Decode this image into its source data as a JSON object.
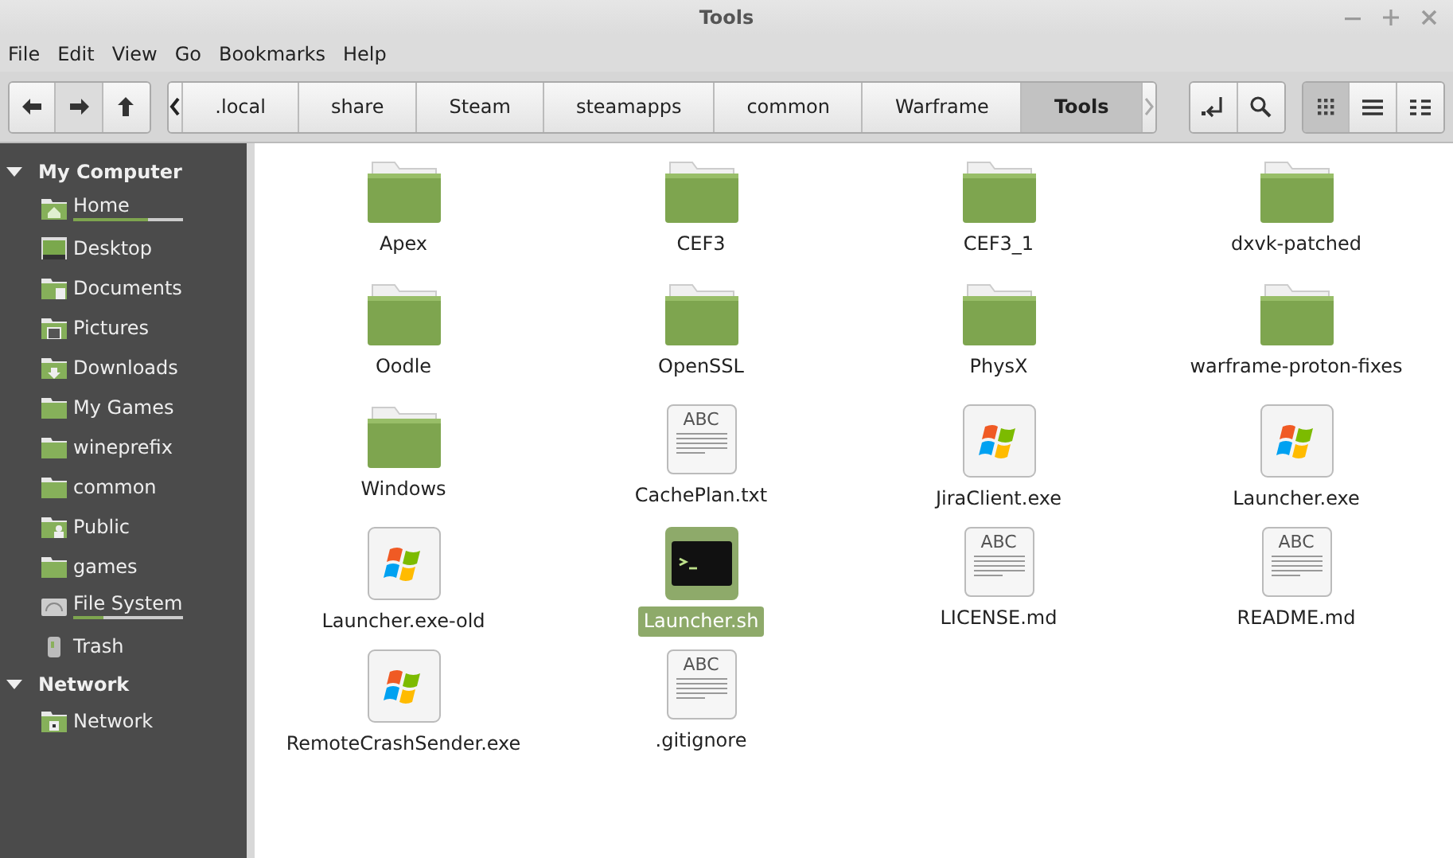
{
  "window": {
    "title": "Tools"
  },
  "menu": [
    "File",
    "Edit",
    "View",
    "Go",
    "Bookmarks",
    "Help"
  ],
  "breadcrumbs": [
    {
      "label": ".local",
      "selected": false
    },
    {
      "label": "share",
      "selected": false
    },
    {
      "label": "Steam",
      "selected": false
    },
    {
      "label": "steamapps",
      "selected": false
    },
    {
      "label": "common",
      "selected": false
    },
    {
      "label": "Warframe",
      "selected": false
    },
    {
      "label": "Tools",
      "selected": true
    }
  ],
  "view_modes": [
    {
      "kind": "icons",
      "selected": true
    },
    {
      "kind": "list",
      "selected": false
    },
    {
      "kind": "compact",
      "selected": false
    }
  ],
  "sidebar": [
    {
      "heading": "My Computer",
      "expanded": true,
      "items": [
        {
          "label": "Home",
          "kind": "home",
          "level": 0.68
        },
        {
          "label": "Desktop",
          "kind": "desktop"
        },
        {
          "label": "Documents",
          "kind": "documents"
        },
        {
          "label": "Pictures",
          "kind": "pictures"
        },
        {
          "label": "Downloads",
          "kind": "downloads"
        },
        {
          "label": "My Games",
          "kind": "folder"
        },
        {
          "label": "wineprefix",
          "kind": "folder"
        },
        {
          "label": "common",
          "kind": "folder"
        },
        {
          "label": "Public",
          "kind": "public"
        },
        {
          "label": "games",
          "kind": "folder"
        },
        {
          "label": "File System",
          "kind": "drive",
          "level": 0.28
        },
        {
          "label": "Trash",
          "kind": "trash"
        }
      ]
    },
    {
      "heading": "Network",
      "expanded": true,
      "items": [
        {
          "label": "Network",
          "kind": "network"
        }
      ]
    }
  ],
  "files": [
    {
      "name": "Apex",
      "kind": "folder",
      "selected": false
    },
    {
      "name": "CEF3",
      "kind": "folder",
      "selected": false
    },
    {
      "name": "CEF3_1",
      "kind": "folder",
      "selected": false
    },
    {
      "name": "dxvk-patched",
      "kind": "folder",
      "selected": false
    },
    {
      "name": "Oodle",
      "kind": "folder",
      "selected": false
    },
    {
      "name": "OpenSSL",
      "kind": "folder",
      "selected": false
    },
    {
      "name": "PhysX",
      "kind": "folder",
      "selected": false
    },
    {
      "name": "warframe-proton-fixes",
      "kind": "folder",
      "selected": false
    },
    {
      "name": "Windows",
      "kind": "folder",
      "selected": false
    },
    {
      "name": "CachePlan.txt",
      "kind": "text",
      "icon_text": "ABC",
      "selected": false
    },
    {
      "name": "JiraClient.exe",
      "kind": "exe",
      "selected": false
    },
    {
      "name": "Launcher.exe",
      "kind": "exe",
      "selected": false
    },
    {
      "name": "Launcher.exe-old",
      "kind": "exe",
      "selected": false
    },
    {
      "name": "Launcher.sh",
      "kind": "script",
      "selected": true
    },
    {
      "name": "LICENSE.md",
      "kind": "text",
      "icon_text": "ABC",
      "selected": false
    },
    {
      "name": "README.md",
      "kind": "text",
      "icon_text": "ABC",
      "selected": false
    },
    {
      "name": "RemoteCrashSender.exe",
      "kind": "exe",
      "selected": false
    },
    {
      "name": ".gitignore",
      "kind": "text",
      "icon_text": "ABC",
      "selected": false
    }
  ]
}
